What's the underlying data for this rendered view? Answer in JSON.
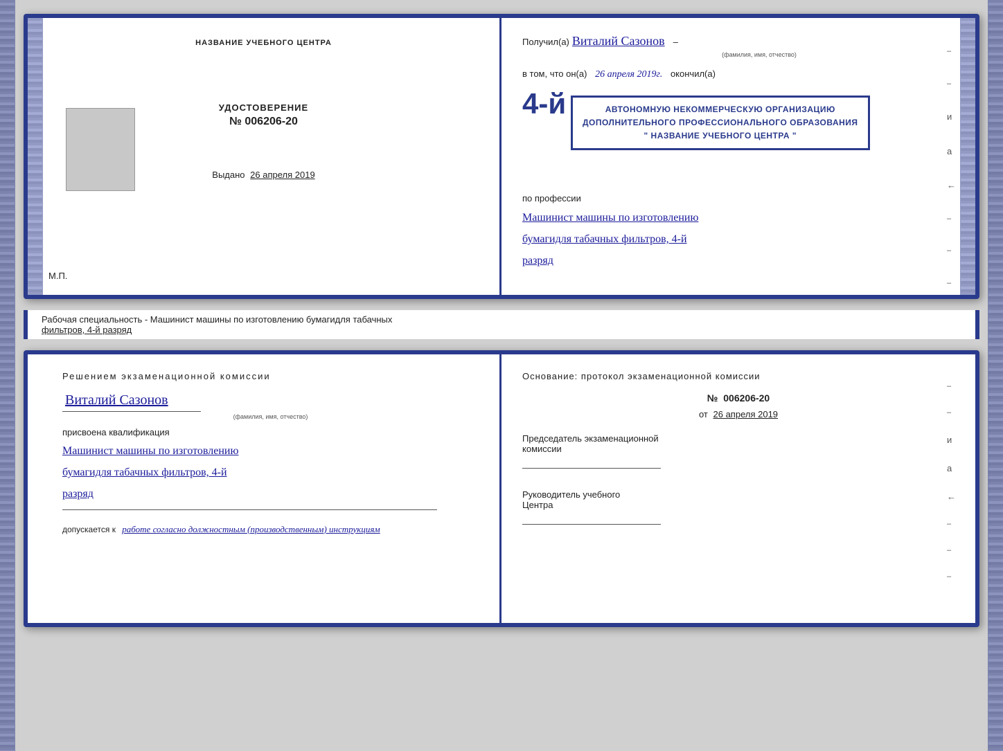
{
  "top_book": {
    "left_page": {
      "title": "НАЗВАНИЕ УЧЕБНОГО ЦЕНТРА",
      "certificate_label": "УДОСТОВЕРЕНИЕ",
      "certificate_number": "№ 006206-20",
      "vydano_label": "Выдано",
      "vydano_date": "26 апреля 2019",
      "mp_label": "М.П."
    },
    "right_page": {
      "poluchil_label": "Получил(а)",
      "recipient_name": "Виталий Сазонов",
      "recipient_caption": "(фамилия, имя, отчество)",
      "vtom_prefix": "в том, что он(а)",
      "date_value": "26 апреля 2019г.",
      "okonchil_label": "окончил(а)",
      "big_number": "4-й",
      "stamp_line1": "АВТОНОМНУЮ НЕКОММЕРЧЕСКУЮ ОРГАНИЗАЦИЮ",
      "stamp_line2": "ДОПОЛНИТЕЛЬНОГО ПРОФЕССИОНАЛЬНОГО ОБРАЗОВАНИЯ",
      "stamp_line3": "\" НАЗВАНИЕ УЧЕБНОГО ЦЕНТРА \"",
      "po_professii_label": "по профессии",
      "profession_line1": "Машинист машины по изготовлению",
      "profession_line2": "бумагидля табачных фильтров, 4-й",
      "profession_line3": "разряд",
      "i_label": "и",
      "a_label": "а",
      "left_arrow": "←"
    }
  },
  "middle_label": {
    "text_prefix": "Рабочая специальность - Машинист машины по изготовлению бумагидля табачных",
    "text_underline": "фильтров, 4-й разряд"
  },
  "bottom_book": {
    "left_page": {
      "title": "Решением  экзаменационной  комиссии",
      "person_name": "Виталий  Сазонов",
      "person_caption": "(фамилия, имя, отчество)",
      "prisvoena_label": "присвоена квалификация",
      "qual_line1": "Машинист машины по изготовлению",
      "qual_line2": "бумагидля табачных фильтров, 4-й",
      "qual_line3": "разряд",
      "dopuskaetsya_prefix": "допускается к",
      "dopuskaetsya_text": "работе согласно должностным (производственным) инструкциям"
    },
    "right_page": {
      "osnovaniye_label": "Основание: протокол экзаменационной  комиссии",
      "number_prefix": "№",
      "number_value": "006206-20",
      "ot_prefix": "от",
      "ot_date": "26 апреля 2019",
      "chairman_label": "Председатель экзаменационной",
      "commission_label": "комиссии",
      "rukovoditel_line1": "Руководитель учебного",
      "rukovoditel_line2": "Центра",
      "i_label": "и",
      "a_label": "а",
      "left_arrow": "←"
    }
  }
}
